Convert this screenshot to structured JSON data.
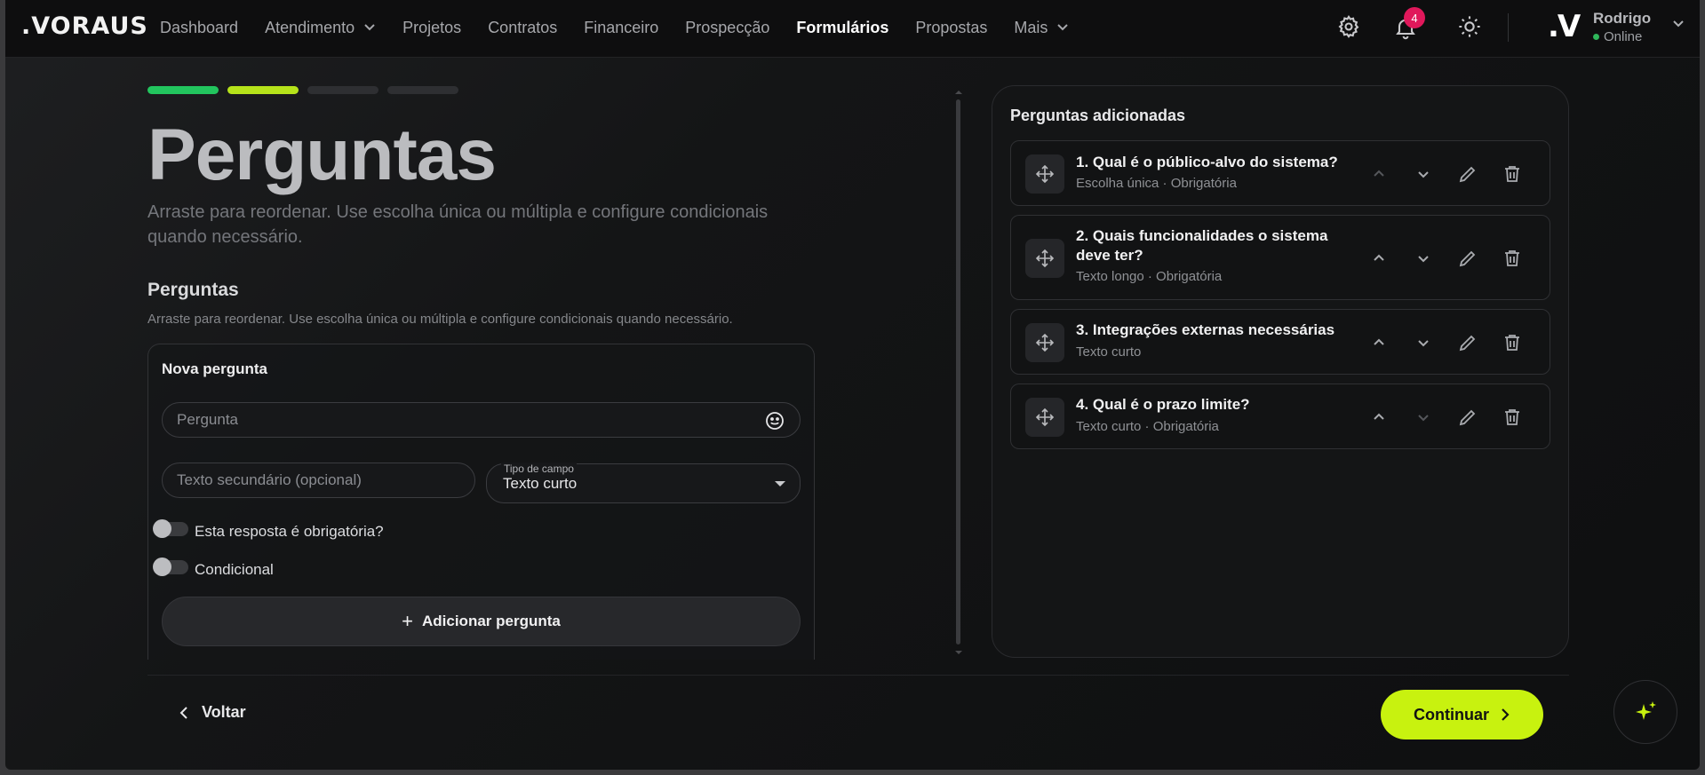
{
  "brand": {
    "logo": ".VORAUS"
  },
  "nav": {
    "items": [
      {
        "label": "Dashboard"
      },
      {
        "label": "Atendimento"
      },
      {
        "label": "Projetos"
      },
      {
        "label": "Contratos"
      },
      {
        "label": "Financeiro"
      },
      {
        "label": "Prospecção"
      },
      {
        "label": "Formulários"
      },
      {
        "label": "Propostas"
      },
      {
        "label": "Mais"
      }
    ],
    "active": "Formulários",
    "notifications_count": "4",
    "icons": [
      "gear-icon",
      "bell-icon",
      "sun-icon"
    ]
  },
  "user": {
    "avatar_text": ".V",
    "name": "Rodrigo",
    "status": "Online"
  },
  "progress": {
    "steps": 4,
    "completed": 2,
    "colors": [
      "#22c55e",
      "#b6e31a",
      "#2e2f32",
      "#2e2f32"
    ]
  },
  "page": {
    "title": "Perguntas",
    "subtitle": "Arraste para reordenar. Use escolha única ou múltipla e configure condicionais quando necessário."
  },
  "section": {
    "title": "Perguntas",
    "subtitle": "Arraste para reordenar. Use escolha única ou múltipla e configure condicionais quando necessário."
  },
  "new_question": {
    "title": "Nova pergunta",
    "question_placeholder": "Pergunta",
    "secondary_placeholder": "Texto secundário (opcional)",
    "field_type_label": "Tipo de campo",
    "field_type_value": "Texto curto",
    "required_label": "Esta resposta é obrigatória?",
    "required": false,
    "conditional_label": "Condicional",
    "conditional": false,
    "add_button": "Adicionar pergunta"
  },
  "added": {
    "title": "Perguntas adicionadas",
    "questions": [
      {
        "text": "1. Qual é o público-alvo do sistema?",
        "meta": "Escolha única · Obrigatória"
      },
      {
        "text": "2. Quais funcionalidades o sistema deve ter?",
        "meta": "Texto longo · Obrigatória"
      },
      {
        "text": "3. Integrações externas necessárias",
        "meta": "Texto curto"
      },
      {
        "text": "4. Qual é o prazo limite?",
        "meta": "Texto curto · Obrigatória"
      }
    ]
  },
  "footer": {
    "back": "Voltar",
    "continue": "Continuar"
  },
  "colors": {
    "accent": "#c8f20f",
    "badge": "#e0185b",
    "online": "#2fb65a"
  }
}
